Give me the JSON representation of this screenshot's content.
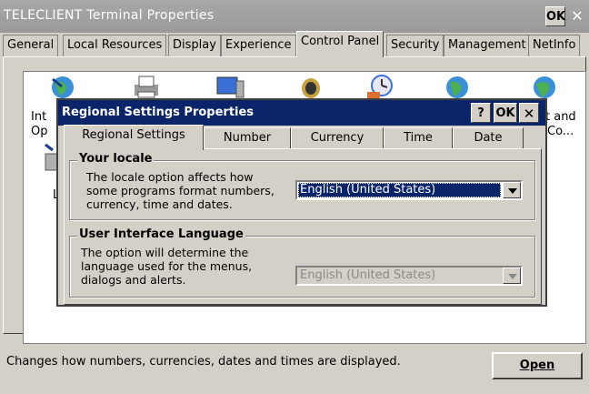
{
  "window": {
    "title": "TELECLIENT Terminal Properties",
    "ok_label": "OK",
    "close_label": "✕"
  },
  "tabs": [
    {
      "label": "General"
    },
    {
      "label": "Local Resources"
    },
    {
      "label": "Display"
    },
    {
      "label": "Experience"
    },
    {
      "label": "Control Panel"
    },
    {
      "label": "Security"
    },
    {
      "label": "Management"
    },
    {
      "label": "NetInfo"
    }
  ],
  "active_tab": "Control Panel",
  "control_panel": {
    "partial_labels": {
      "left_top": "Int",
      "left_mid": "Op",
      "left_bot": "L",
      "right_top": "t and",
      "right_mid": "Co..."
    },
    "status_text": "Changes how numbers, currencies, dates and times are displayed.",
    "open_label": "Open"
  },
  "dialog": {
    "title": "Regional Settings Properties",
    "help_label": "?",
    "ok_label": "OK",
    "close_label": "✕",
    "tabs": [
      {
        "label": "Regional Settings"
      },
      {
        "label": "Number"
      },
      {
        "label": "Currency"
      },
      {
        "label": "Time"
      },
      {
        "label": "Date"
      }
    ],
    "your_locale": {
      "title": "Your locale",
      "description": [
        "The locale option affects how",
        "some programs format numbers,",
        "currency, time and dates."
      ],
      "value": "English (United States)"
    },
    "ui_language": {
      "title": "User Interface Language",
      "description": [
        "The option will determine the",
        "language used for the menus,",
        "dialogs and alerts."
      ],
      "value": "English (United States)"
    }
  },
  "colors": {
    "dialog_title_bg": "#0a246a",
    "selection_bg": "#0a246a"
  }
}
